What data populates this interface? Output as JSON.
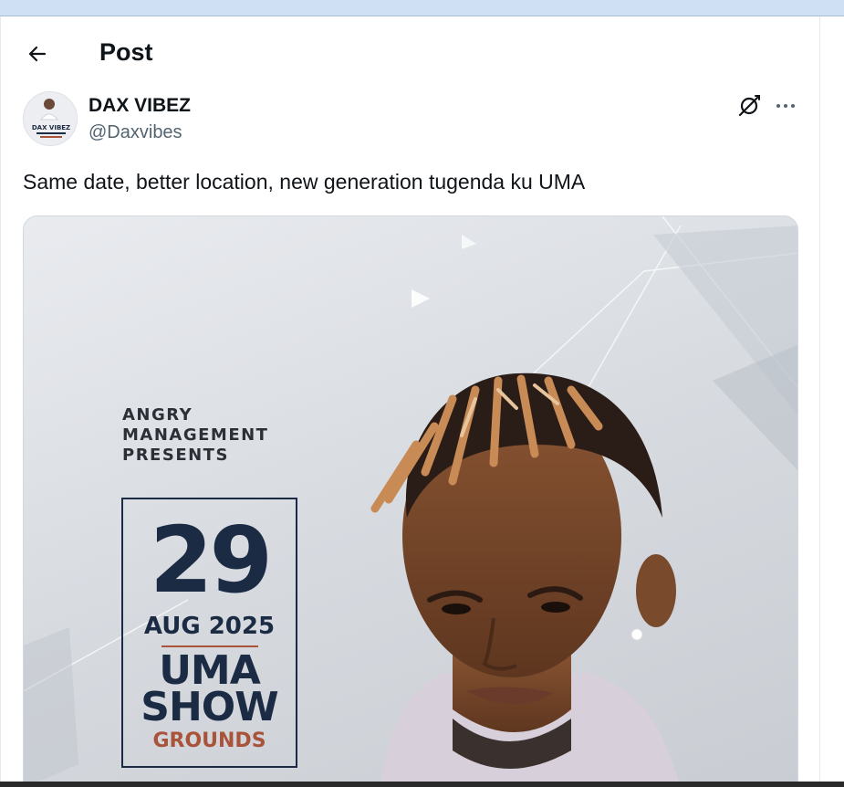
{
  "header": {
    "title": "Post",
    "back_icon": "arrow-left-icon"
  },
  "post": {
    "author": {
      "display_name": "DAX VIBEZ",
      "handle": "@Daxvibes",
      "avatar_text": "DAX VIBEZ"
    },
    "text": "Same date, better location, new generation tugenda ku UMA",
    "actions": {
      "grok_icon": "grok-icon",
      "more_icon": "more-icon"
    }
  },
  "poster": {
    "presents_lines": [
      "ANGRY",
      "MANAGEMENT",
      "PRESENTS"
    ],
    "day": "29",
    "month_year": "AUG 2025",
    "venue_lines": [
      "UMA",
      "SHOW"
    ],
    "venue_sub": "GROUNDS"
  },
  "colors": {
    "navy": "#1c2b44",
    "rust": "#a9543a",
    "muted": "#536471"
  }
}
